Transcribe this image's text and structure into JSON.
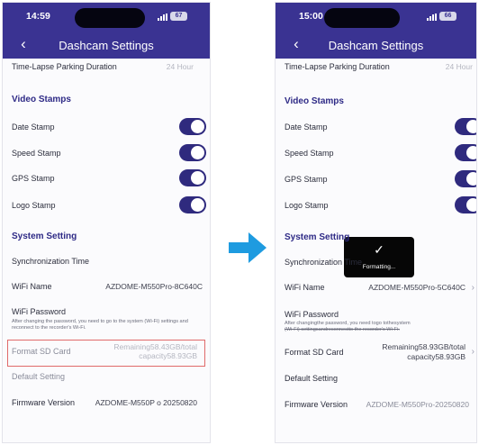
{
  "left": {
    "status": {
      "time": "14:59",
      "battery": "67"
    },
    "header": {
      "title": "Dashcam Settings"
    },
    "parking": {
      "label": "Time-Lapse Parking Duration",
      "value": "24 Hour"
    },
    "video_stamps": {
      "title": "Video Stamps",
      "items": [
        {
          "label": "Date Stamp",
          "on": true
        },
        {
          "label": "Speed Stamp",
          "on": true
        },
        {
          "label": "GPS Stamp",
          "on": true
        },
        {
          "label": "Logo Stamp",
          "on": true
        }
      ]
    },
    "system": {
      "title": "System Setting",
      "sync_label": "Synchronization Time",
      "wifi_name_label": "WiFi Name",
      "wifi_name_value": "AZDOME-M550Pro-8C640C",
      "wifi_password_label": "WiFi Password",
      "wifi_password_note": "After changing the password, you need to go to the system (Wi-Fi) settings and reconnect to the recorder's Wi-Fi.",
      "format_label": "Format SD Card",
      "format_value_1": "Remaining58.43GB/total",
      "format_value_2": "capacity58.93GB",
      "default_label": "Default Setting",
      "firmware_label": "Firmware Version",
      "firmware_value": "AZDOME-M550P o 20250820"
    }
  },
  "right": {
    "status": {
      "time": "15:00",
      "battery": "66"
    },
    "header": {
      "title": "Dashcam Settings"
    },
    "parking": {
      "label": "Time-Lapse Parking Duration",
      "value": "24 Hour"
    },
    "video_stamps": {
      "title": "Video Stamps",
      "items": [
        {
          "label": "Date Stamp",
          "on": true
        },
        {
          "label": "Speed Stamp",
          "on": true
        },
        {
          "label": "GPS Stamp",
          "on": true
        },
        {
          "label": "Logo Stamp",
          "on": true
        }
      ]
    },
    "system": {
      "title": "System Setting",
      "sync_label": "Synchronization Time",
      "wifi_name_label": "WiFi Name",
      "wifi_name_value": "AZDOME-M550Pro-5C640C",
      "wifi_password_label": "WiFi Password",
      "wifi_password_note": "After changingthe password, you need togo tothesystem",
      "wifi_password_note_2": "(Wi-Fi) settingsandreconnectto the recorder's Wi-Fi.",
      "format_label": "Format SD Card",
      "format_value_1": "Remaining58.93GB/total",
      "format_value_2": "capacity58.93GB",
      "default_label": "Default Setting",
      "firmware_label": "Firmware Version",
      "firmware_value": "AZDOME-M550Pro-20250820"
    },
    "toast": {
      "text": "Formatting..."
    }
  },
  "colors": {
    "header": "#3a3392",
    "toggle": "#2f2a7e",
    "section": "#2e2a86",
    "highlight": "#e06a6a",
    "arrow": "#1e9be0"
  },
  "icons": [
    "chevron-left-icon",
    "signal-icon",
    "battery-icon",
    "chevron-right-icon",
    "checkmark-icon",
    "arrow-right-icon"
  ]
}
